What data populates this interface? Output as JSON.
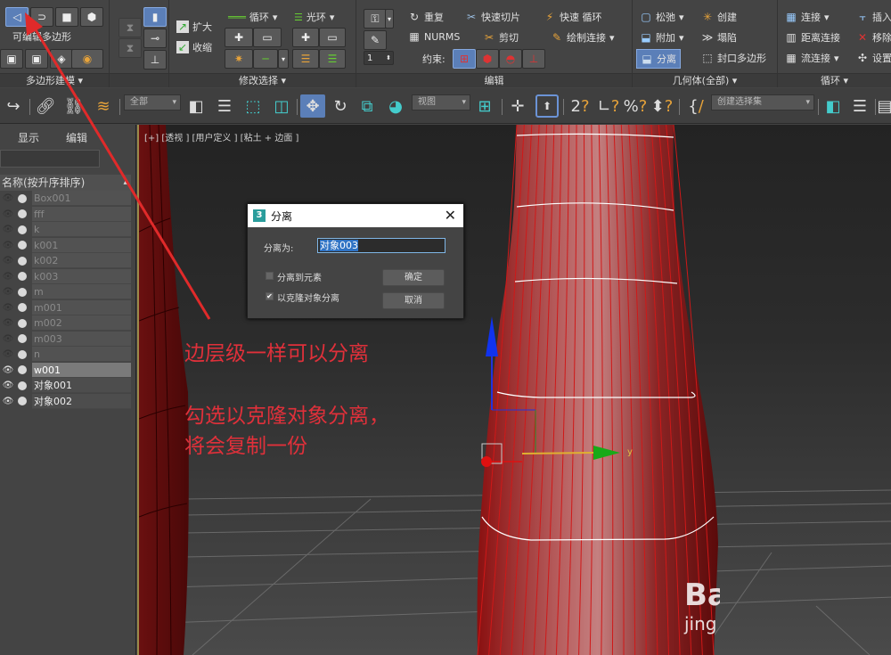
{
  "ribbon": {
    "groups": [
      {
        "label": "多边形建模",
        "title": "可编辑多边形"
      },
      {
        "label": "修改选择",
        "items": [
          "扩大",
          "收缩",
          "循环",
          "光环"
        ]
      },
      {
        "label": "编辑",
        "items": [
          "重复",
          "快速切片",
          "快速 循环",
          "NURMS",
          "剪切",
          "绘制连接"
        ],
        "constraint_label": "约束:",
        "spinner_value": "1"
      },
      {
        "label": "几何体(全部)",
        "items": [
          "松弛",
          "创建",
          "附加",
          "塌陷",
          "分离",
          "封口多边形"
        ]
      },
      {
        "label": "循环",
        "items": [
          "连接",
          "插入",
          "距离连接",
          "移除",
          "流连接",
          "设置"
        ]
      }
    ]
  },
  "toolbar": {
    "filter_dropdown": "全部",
    "coord_dropdown": "视图",
    "selection_set_dropdown": "创建选择集"
  },
  "scene_explorer": {
    "tabs": [
      "显示",
      "编辑"
    ],
    "column_header": "名称(按升序排序)",
    "objects": [
      {
        "name": "Box001",
        "visible": false,
        "selected": false
      },
      {
        "name": "fff",
        "visible": false,
        "selected": false
      },
      {
        "name": "k",
        "visible": false,
        "selected": false
      },
      {
        "name": "k001",
        "visible": false,
        "selected": false
      },
      {
        "name": "k002",
        "visible": false,
        "selected": false
      },
      {
        "name": "k003",
        "visible": false,
        "selected": false
      },
      {
        "name": "m",
        "visible": false,
        "selected": false
      },
      {
        "name": "m001",
        "visible": false,
        "selected": false
      },
      {
        "name": "m002",
        "visible": false,
        "selected": false
      },
      {
        "name": "m003",
        "visible": false,
        "selected": false
      },
      {
        "name": "n",
        "visible": false,
        "selected": false
      },
      {
        "name": "w001",
        "visible": true,
        "selected": true
      },
      {
        "name": "对象001",
        "visible": true,
        "selected": false
      },
      {
        "name": "对象002",
        "visible": true,
        "selected": false
      }
    ]
  },
  "viewport": {
    "label": "[+] [透视 ] [用户定义 ] [粘土 + 边面 ]",
    "gizmo_axis_y": "y",
    "gizmo_axis_z": "z"
  },
  "dialog": {
    "app_icon": "3",
    "title": "分离",
    "name_label": "分离为:",
    "name_value": "对象003",
    "option1_label": "分离到元素",
    "option1_checked": false,
    "option2_label": "以克隆对象分离",
    "option2_checked": true,
    "ok_label": "确定",
    "cancel_label": "取消"
  },
  "annotations": {
    "line1": "边层级一样可以分离",
    "line2": "勾选以克隆对象分离，",
    "line3": "将会复制一份",
    "color": "#e0303a"
  },
  "watermark": {
    "line1": "Ba",
    "line2": "jing"
  }
}
